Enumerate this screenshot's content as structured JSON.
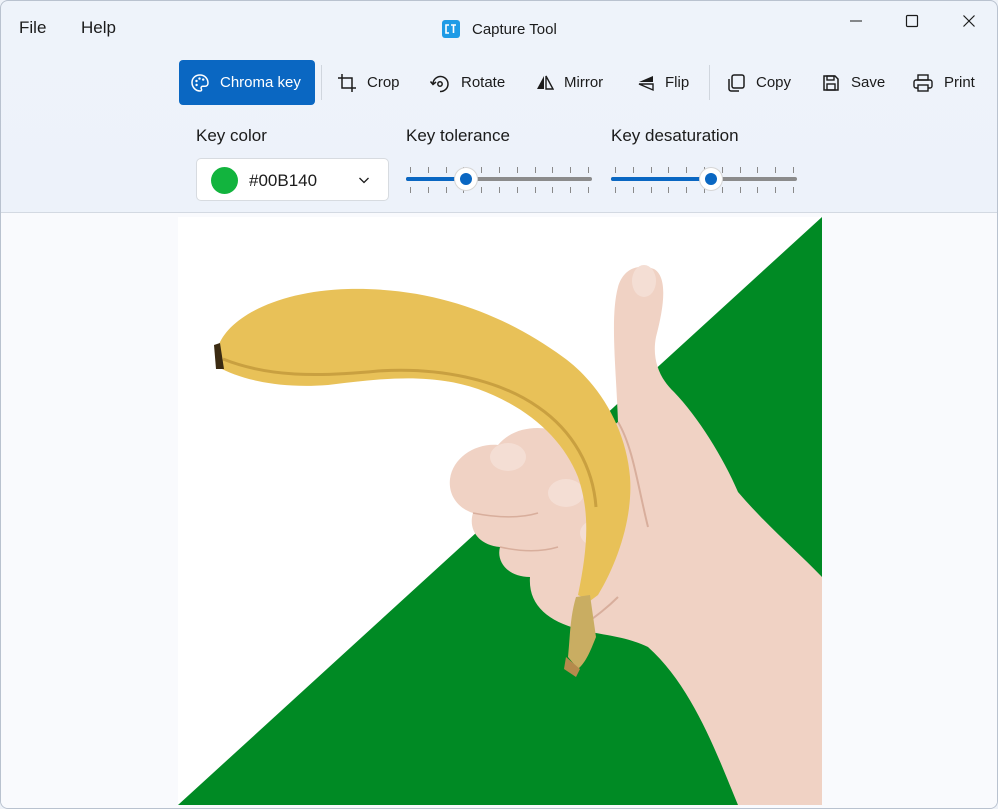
{
  "menu": {
    "file": "File",
    "help": "Help"
  },
  "app": {
    "title": "Capture Tool"
  },
  "toolbar": {
    "chroma_key": "Chroma key",
    "crop": "Crop",
    "rotate": "Rotate",
    "mirror": "Mirror",
    "flip": "Flip",
    "copy": "Copy",
    "save": "Save",
    "print": "Print"
  },
  "controls": {
    "key_color_label": "Key color",
    "key_color_value": "#00B140",
    "key_color_swatch": "#12B43E",
    "key_tolerance_label": "Key tolerance",
    "key_tolerance_value": 0.32,
    "key_desaturation_label": "Key desaturation",
    "key_desaturation_value": 0.54
  },
  "colors": {
    "accent": "#0A67C2",
    "background_green": "#008A24"
  }
}
